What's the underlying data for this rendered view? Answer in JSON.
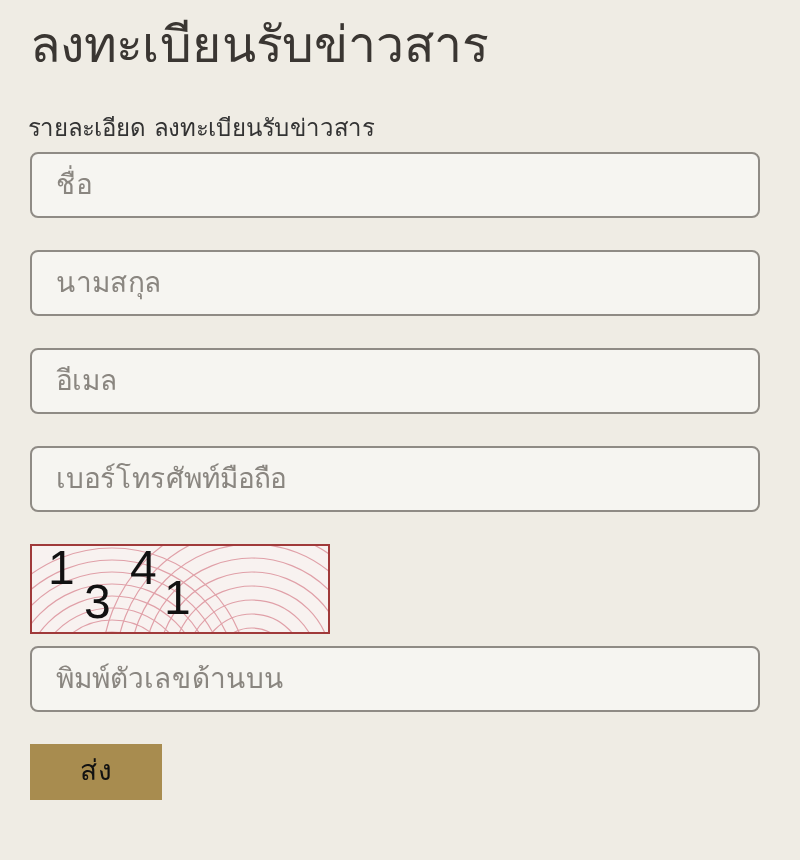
{
  "title": "ลงทะเบียนรับข่าวสาร",
  "subtitle": "รายละเอียด ลงทะเบียนรับข่าวสาร",
  "fields": [
    {
      "placeholder": "ชื่อ"
    },
    {
      "placeholder": "นามสกุล"
    },
    {
      "placeholder": "อีเมล"
    },
    {
      "placeholder": "เบอร์โทรศัพท์มือถือ"
    }
  ],
  "captcha": {
    "characters": [
      "1",
      "3",
      "4",
      "1"
    ]
  },
  "captcha_field": {
    "placeholder": "พิมพ์ตัวเลขด้านบน"
  },
  "submit_button": "ส่ง"
}
